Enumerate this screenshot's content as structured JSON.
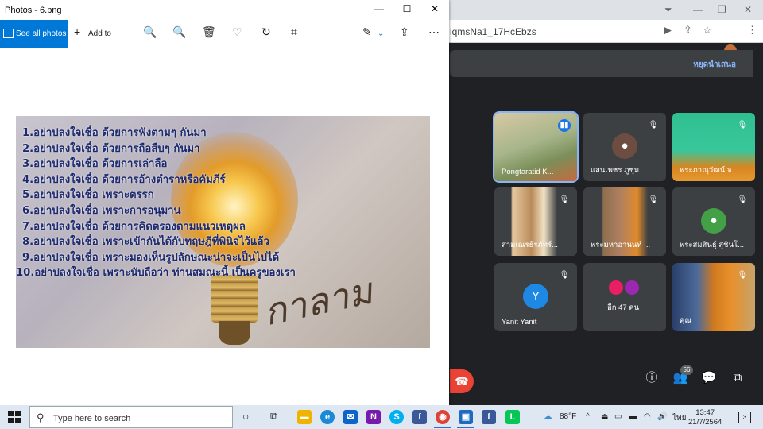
{
  "chrome": {
    "url": "iqmsNa1_17HcEbzs",
    "stop_presenting": "หยุดนำเสนอ",
    "participants_badge": "56"
  },
  "tiles": [
    {
      "name": "Pongtaratid K...",
      "kind": "photo",
      "active": true
    },
    {
      "name": "แสนเพชร ภูชุม",
      "kind": "avatar",
      "avatar_color": "#6d4c41",
      "initial": ""
    },
    {
      "name": "พระภาณุวัฒน์ จ...",
      "kind": "photo"
    },
    {
      "name": "สามเณรธีรภัทร์...",
      "kind": "photo"
    },
    {
      "name": "พระมหาอานนท์ ...",
      "kind": "photo"
    },
    {
      "name": "พระสมสินธุ์ สุชินโ...",
      "kind": "avatar",
      "avatar_color": "#43a047",
      "initial": ""
    },
    {
      "name": "Yanit Yanit",
      "kind": "avatar",
      "avatar_color": "#1e88e5",
      "initial": "Y"
    },
    {
      "name": "อีก 47 คน",
      "kind": "group"
    },
    {
      "name": "คุณ",
      "kind": "photo"
    }
  ],
  "photos": {
    "title": "Photos - 6.png",
    "see_all": "See all photos",
    "add_to": "Add to",
    "lines": [
      "1.อย่าปลงใจเชื่อ ด้วยการฟังตามๆ กันมา",
      "2.อย่าปลงใจเชื่อ ด้วยการถือสืบๆ กันมา",
      "3.อย่าปลงใจเชื่อ ด้วยการเล่าลือ",
      "4.อย่าปลงใจเชื่อ ด้วยการอ้างตำราหรือคัมภีร์",
      "5.อย่าปลงใจเชื่อ เพราะตรรก",
      "6.อย่าปลงใจเชื่อ เพราะการอนุมาน",
      "7.อย่าปลงใจเชื่อ ด้วยการคิดตรองตามแนวเหตุผล",
      "8.อย่าปลงใจเชื่อ เพราะเข้ากันได้กับทฤษฎีที่พินิจไว้แล้ว",
      "9.อย่าปลงใจเชื่อ เพราะมองเห็นรูปลักษณะน่าจะเป็นไปได้",
      "10.อย่าปลงใจเชื่อ เพราะนับถือว่า ท่านสมณะนี้ เป็นครูของเรา"
    ],
    "signature": "กาลามสูตร"
  },
  "taskbar": {
    "search_placeholder": "Type here to search",
    "weather": "88°F",
    "language": "ไทย",
    "time": "13:47",
    "date": "21/7/2564",
    "notifications": "3"
  }
}
